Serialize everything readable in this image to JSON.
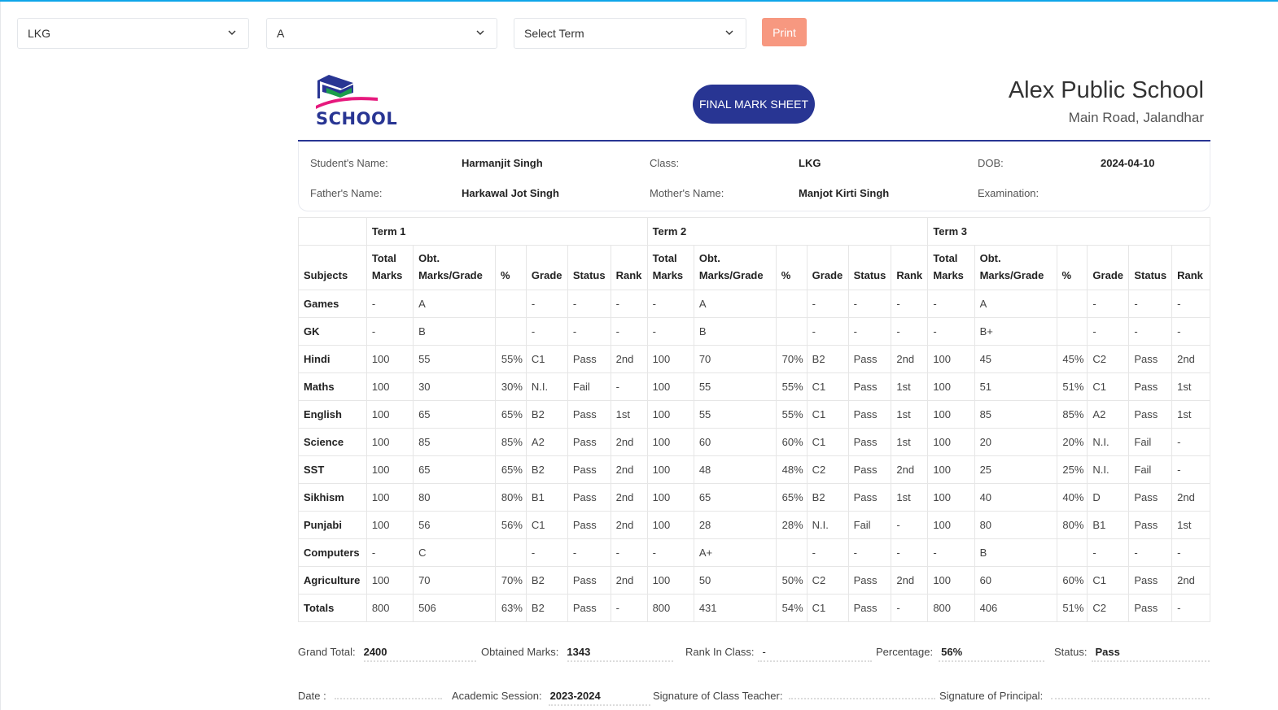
{
  "filters": {
    "class_select": "LKG",
    "section_select": "A",
    "term_select": "Select Term",
    "print_label": "Print"
  },
  "header": {
    "logo_text": "SCHOOL",
    "title": "FINAL MARK SHEET",
    "school_name": "Alex Public School",
    "school_address": "Main Road, Jalandhar"
  },
  "student": {
    "name_label": "Student's Name:",
    "name": "Harmanjit Singh",
    "class_label": "Class:",
    "class": "LKG",
    "dob_label": "DOB:",
    "dob": "2024-04-10",
    "father_label": "Father's Name:",
    "father": "Harkawal Jot Singh",
    "mother_label": "Mother's Name:",
    "mother": "Manjot Kirti Singh",
    "exam_label": "Examination:",
    "exam": ""
  },
  "table": {
    "terms": [
      "Term 1",
      "Term 2",
      "Term 3"
    ],
    "subjects_header": "Subjects",
    "columns": [
      "Total Marks",
      "Obt. Marks/Grade",
      "%",
      "Grade",
      "Status",
      "Rank"
    ],
    "rows": [
      {
        "subject": "Games",
        "terms": [
          [
            "-",
            "A",
            "",
            "-",
            "-",
            "-"
          ],
          [
            "-",
            "A",
            "",
            "-",
            "-",
            "-"
          ],
          [
            "-",
            "A",
            "",
            "-",
            "-",
            "-"
          ]
        ]
      },
      {
        "subject": "GK",
        "terms": [
          [
            "-",
            "B",
            "",
            "-",
            "-",
            "-"
          ],
          [
            "-",
            "B",
            "",
            "-",
            "-",
            "-"
          ],
          [
            "-",
            "B+",
            "",
            "-",
            "-",
            "-"
          ]
        ]
      },
      {
        "subject": "Hindi",
        "terms": [
          [
            "100",
            "55",
            "55%",
            "C1",
            "Pass",
            "2nd"
          ],
          [
            "100",
            "70",
            "70%",
            "B2",
            "Pass",
            "2nd"
          ],
          [
            "100",
            "45",
            "45%",
            "C2",
            "Pass",
            "2nd"
          ]
        ]
      },
      {
        "subject": "Maths",
        "terms": [
          [
            "100",
            "30",
            "30%",
            "N.I.",
            "Fail",
            "-"
          ],
          [
            "100",
            "55",
            "55%",
            "C1",
            "Pass",
            "1st"
          ],
          [
            "100",
            "51",
            "51%",
            "C1",
            "Pass",
            "1st"
          ]
        ]
      },
      {
        "subject": "English",
        "terms": [
          [
            "100",
            "65",
            "65%",
            "B2",
            "Pass",
            "1st"
          ],
          [
            "100",
            "55",
            "55%",
            "C1",
            "Pass",
            "1st"
          ],
          [
            "100",
            "85",
            "85%",
            "A2",
            "Pass",
            "1st"
          ]
        ]
      },
      {
        "subject": "Science",
        "terms": [
          [
            "100",
            "85",
            "85%",
            "A2",
            "Pass",
            "2nd"
          ],
          [
            "100",
            "60",
            "60%",
            "C1",
            "Pass",
            "1st"
          ],
          [
            "100",
            "20",
            "20%",
            "N.I.",
            "Fail",
            "-"
          ]
        ]
      },
      {
        "subject": "SST",
        "terms": [
          [
            "100",
            "65",
            "65%",
            "B2",
            "Pass",
            "2nd"
          ],
          [
            "100",
            "48",
            "48%",
            "C2",
            "Pass",
            "2nd"
          ],
          [
            "100",
            "25",
            "25%",
            "N.I.",
            "Fail",
            "-"
          ]
        ]
      },
      {
        "subject": "Sikhism",
        "terms": [
          [
            "100",
            "80",
            "80%",
            "B1",
            "Pass",
            "2nd"
          ],
          [
            "100",
            "65",
            "65%",
            "B2",
            "Pass",
            "1st"
          ],
          [
            "100",
            "40",
            "40%",
            "D",
            "Pass",
            "2nd"
          ]
        ]
      },
      {
        "subject": "Punjabi",
        "terms": [
          [
            "100",
            "56",
            "56%",
            "C1",
            "Pass",
            "2nd"
          ],
          [
            "100",
            "28",
            "28%",
            "N.I.",
            "Fail",
            "-"
          ],
          [
            "100",
            "80",
            "80%",
            "B1",
            "Pass",
            "1st"
          ]
        ]
      },
      {
        "subject": "Computers",
        "terms": [
          [
            "-",
            "C",
            "",
            "-",
            "-",
            "-"
          ],
          [
            "-",
            "A+",
            "",
            "-",
            "-",
            "-"
          ],
          [
            "-",
            "B",
            "",
            "-",
            "-",
            "-"
          ]
        ]
      },
      {
        "subject": "Agriculture",
        "terms": [
          [
            "100",
            "70",
            "70%",
            "B2",
            "Pass",
            "2nd"
          ],
          [
            "100",
            "50",
            "50%",
            "C2",
            "Pass",
            "2nd"
          ],
          [
            "100",
            "60",
            "60%",
            "C1",
            "Pass",
            "2nd"
          ]
        ]
      },
      {
        "subject": "Totals",
        "terms": [
          [
            "800",
            "506",
            "63%",
            "B2",
            "Pass",
            "-"
          ],
          [
            "800",
            "431",
            "54%",
            "C1",
            "Pass",
            "-"
          ],
          [
            "800",
            "406",
            "51%",
            "C2",
            "Pass",
            "-"
          ]
        ]
      }
    ]
  },
  "summary": {
    "grand_total_label": "Grand Total:",
    "grand_total": "2400",
    "obtained_label": "Obtained Marks:",
    "obtained": "1343",
    "rank_label": "Rank In Class:",
    "rank": "-",
    "percentage_label": "Percentage:",
    "percentage": "56%",
    "status_label": "Status:",
    "status": "Pass",
    "date_label": "Date :",
    "session_label": "Academic Session:",
    "session": "2023-2024",
    "teacher_sig_label": "Signature of Class Teacher:",
    "principal_sig_label": "Signature of Principal:"
  }
}
